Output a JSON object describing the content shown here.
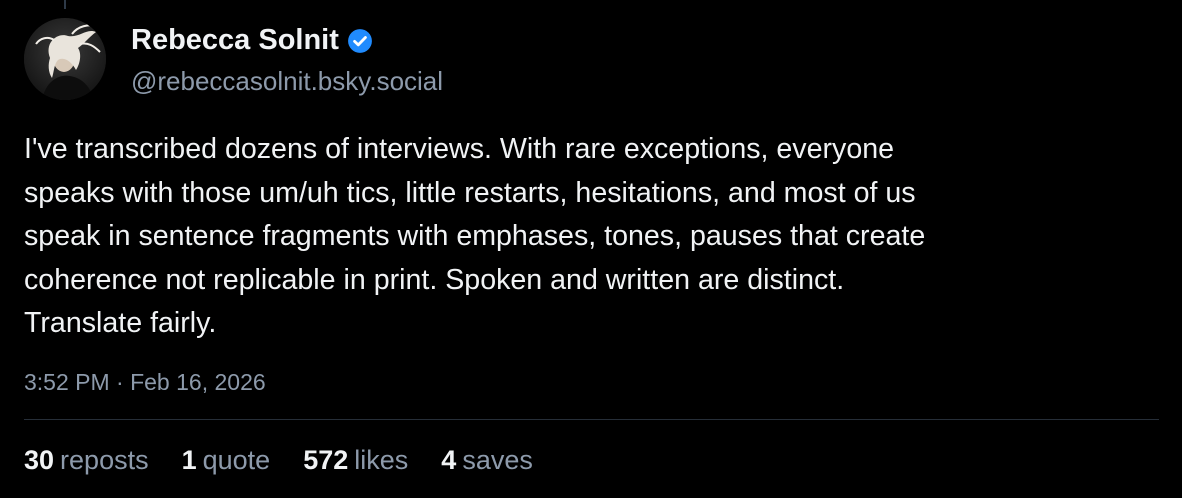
{
  "author": {
    "display_name": "Rebecca Solnit",
    "handle": "@rebeccasolnit.bsky.social",
    "verified": true,
    "verified_color": "#208bfe"
  },
  "post": {
    "text": "I've transcribed dozens of interviews. With rare exceptions, everyone\nspeaks with those um/uh tics, little restarts, hesitations, and most of us\nspeak in sentence fragments with emphases, tones, pauses that create\ncoherence not replicable in print. Spoken and written are distinct.\nTranslate fairly.",
    "timestamp": "3:52 PM · Feb 16, 2026"
  },
  "stats": [
    {
      "count": "30",
      "label": "reposts"
    },
    {
      "count": "1",
      "label": "quote"
    },
    {
      "count": "572",
      "label": "likes"
    },
    {
      "count": "4",
      "label": "saves"
    }
  ],
  "colors": {
    "background": "#000000",
    "text": "#f1f3f5",
    "muted": "#8d9aab",
    "divider": "#262e38"
  }
}
